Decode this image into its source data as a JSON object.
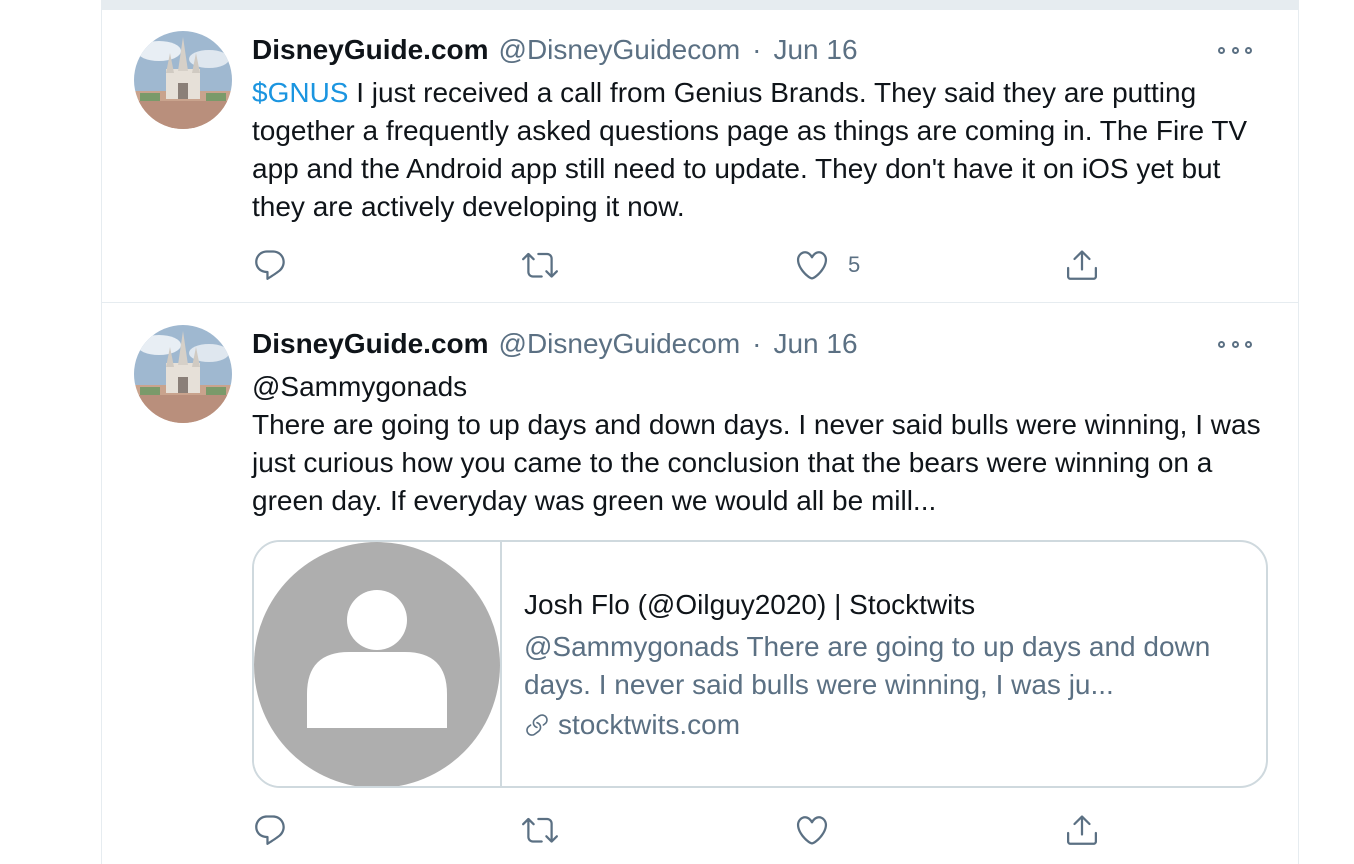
{
  "colors": {
    "link": "#1b95e0",
    "secondary_text": "#5b7083",
    "border": "#cfd9de"
  },
  "tweets": [
    {
      "display_name": "DisneyGuide.com",
      "handle": "@DisneyGuidecom",
      "separator": "·",
      "date": "Jun 16",
      "cashtag": "$GNUS",
      "text": " I just received a call from Genius Brands. They said they are putting together a frequently asked questions page as things are coming in. The Fire TV app and the Android app still need to update. They don't have it on iOS yet but they are actively developing it now.",
      "like_count": "5",
      "icons": [
        "reply-icon",
        "retweet-icon",
        "like-icon",
        "share-icon"
      ]
    },
    {
      "display_name": "DisneyGuide.com",
      "handle": "@DisneyGuidecom",
      "separator": "·",
      "date": "Jun 16",
      "mention_line": "@Sammygonads",
      "text": "There are going to up days and down days. I never said bulls were winning, I was just curious how you came to the conclusion that the bears were winning on a green day. If everyday was green we would all be mill...",
      "card": {
        "title": "Josh Flo (@Oilguy2020) | Stocktwits",
        "description": "@Sammygonads There are going to up days and down days. I never said bulls were winning, I was ju...",
        "domain": "stocktwits.com",
        "image_icon": "default-profile-icon",
        "link_icon": "link-icon"
      },
      "icons": [
        "reply-icon",
        "retweet-icon",
        "like-icon",
        "share-icon"
      ]
    }
  ]
}
